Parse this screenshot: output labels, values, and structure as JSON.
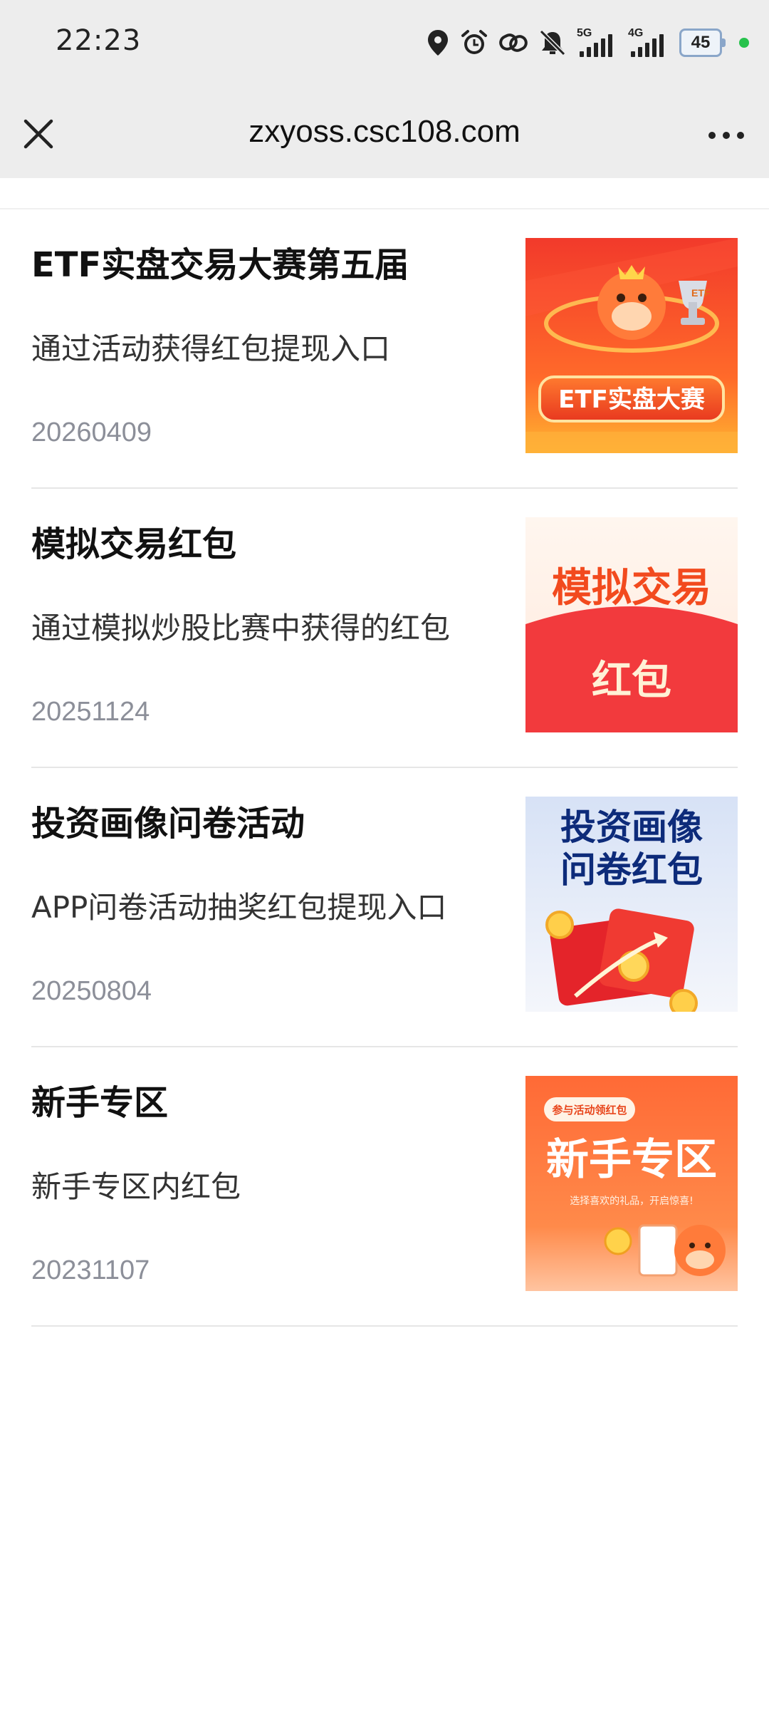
{
  "status_bar": {
    "time": "22:23",
    "network_1": "5G",
    "network_2": "4G",
    "battery": "45",
    "icons": [
      "location-icon",
      "alarm-icon",
      "link-icon",
      "mute-icon"
    ]
  },
  "nav": {
    "url": "zxyoss.csc108.com",
    "close_icon": "close-icon",
    "more_icon": "more-icon"
  },
  "items": [
    {
      "title": "ETF实盘交易大赛第五届",
      "desc": "通过活动获得红包提现入口",
      "date": "20260409",
      "thumb_text": "ETF实盘大赛",
      "thumb_badge": "ETF"
    },
    {
      "title": "模拟交易红包",
      "desc": "通过模拟炒股比赛中获得的红包",
      "date": "20251124",
      "thumb_line1": "模拟交易",
      "thumb_line2": "红包"
    },
    {
      "title": "投资画像问卷活动",
      "desc": "APP问卷活动抽奖红包提现入口",
      "date": "20250804",
      "thumb_line1": "投资画像",
      "thumb_line2": "问卷红包"
    },
    {
      "title": "新手专区",
      "desc": "新手专区内红包",
      "date": "20231107",
      "thumb_badge": "参与活动领红包",
      "thumb_text": "新手专区",
      "thumb_sub": "选择喜欢的礼品，开启惊喜!"
    }
  ],
  "colors": {
    "accent_red": "#f0463c",
    "accent_orange": "#ff7a32",
    "bar_bg": "#ededed",
    "date_gray": "#8c8f99"
  }
}
